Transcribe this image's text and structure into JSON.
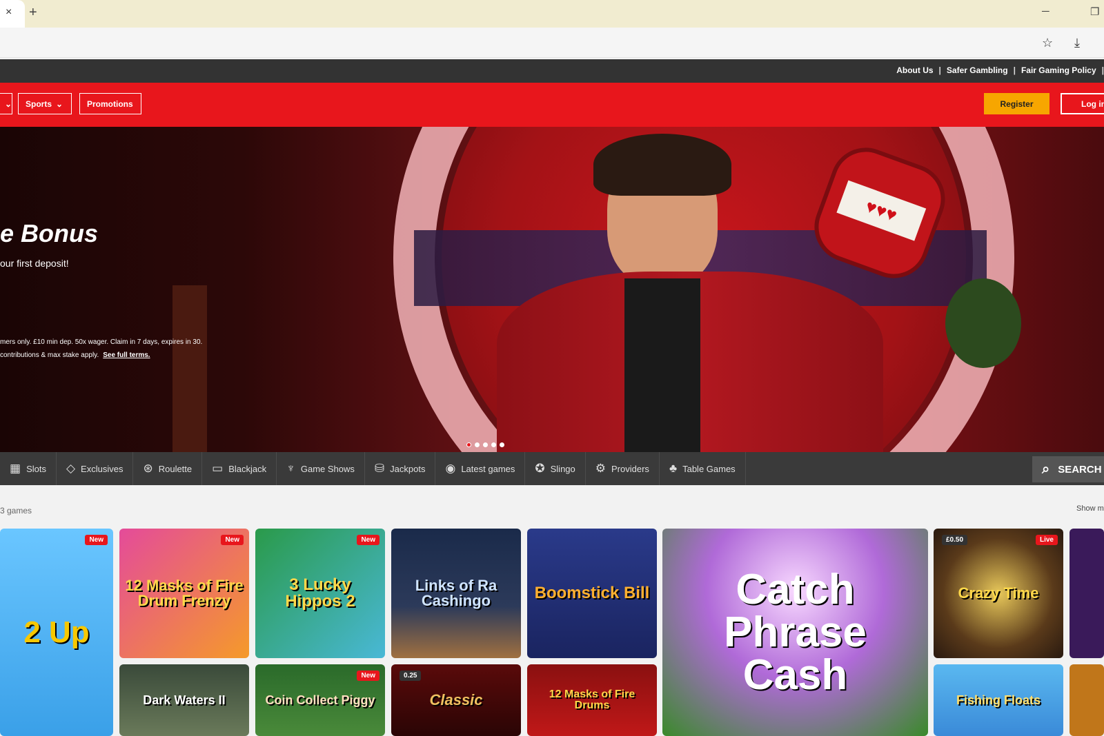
{
  "browser": {
    "tab_close": "×",
    "new_tab": "+",
    "minimize": "─",
    "restore": "❐",
    "icons": [
      "star-icon",
      "download-icon"
    ]
  },
  "top_links": [
    "About Us",
    "Safer Gambling",
    "Fair Gaming Policy"
  ],
  "nav": {
    "sports": "Sports",
    "promotions": "Promotions",
    "register": "Register",
    "login": "Log in"
  },
  "hero": {
    "title": "e Bonus",
    "subtitle": "our first deposit!",
    "terms_line1": "mers only. £10 min dep. 50x wager. Claim in 7 days, expires in 30.",
    "terms_line2": "contributions & max stake apply.",
    "terms_link": "See full terms.",
    "slide_count": 5,
    "active_slide": 0
  },
  "categories": [
    {
      "label": "Slots",
      "icon": "slots-icon"
    },
    {
      "label": "Exclusives",
      "icon": "diamond-icon"
    },
    {
      "label": "Roulette",
      "icon": "roulette-icon"
    },
    {
      "label": "Blackjack",
      "icon": "cards-icon"
    },
    {
      "label": "Game Shows",
      "icon": "microphone-icon"
    },
    {
      "label": "Jackpots",
      "icon": "jackpot-icon"
    },
    {
      "label": "Latest games",
      "icon": "new-icon"
    },
    {
      "label": "Slingo",
      "icon": "slingo-icon"
    },
    {
      "label": "Providers",
      "icon": "providers-icon"
    },
    {
      "label": "Table Games",
      "icon": "table-icon"
    }
  ],
  "search_label": "SEARCH",
  "games_count": "3 games",
  "show_more": "Show m",
  "games": [
    {
      "name": "2 Up",
      "badge": "New"
    },
    {
      "name": "12 Masks of Fire Drum Frenzy",
      "badge": "New"
    },
    {
      "name": "3 Lucky Hippos 2",
      "badge": "New"
    },
    {
      "name": "Links of Ra Cashingo",
      "badge": ""
    },
    {
      "name": "Boomstick Bill",
      "badge": ""
    },
    {
      "name": "Catch Phrase Cash",
      "badge": ""
    },
    {
      "name": "Crazy Time",
      "badge": "Live",
      "stake": "£0.50"
    },
    {
      "name": "Dark Waters II",
      "badge": ""
    },
    {
      "name": "Coin Collect Piggy",
      "badge": "New"
    },
    {
      "name": "Classic",
      "badge": "",
      "stake": "0.25"
    },
    {
      "name": "12 Masks of Fire Drums",
      "badge": ""
    },
    {
      "name": "Fishing Floats",
      "badge": ""
    }
  ],
  "colors": {
    "brand_red": "#e8161c",
    "register_orange": "#f7a600",
    "dark_strip": "#333333"
  }
}
